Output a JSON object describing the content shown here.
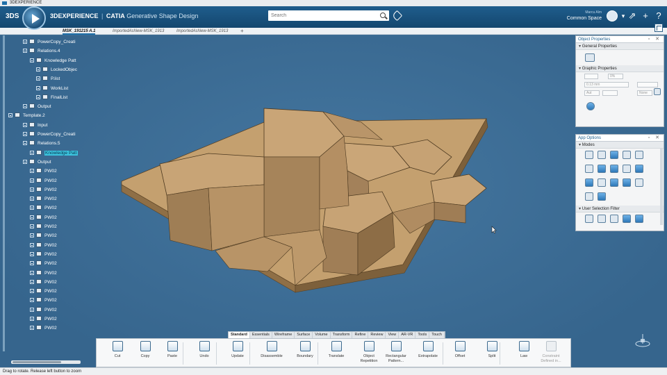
{
  "os_window": {
    "title": "3DEXPERIENCE"
  },
  "header": {
    "ds_logo": "3DS",
    "brand": {
      "platform": "3DEXPERIENCE",
      "separator": "|",
      "product": "CATIA",
      "app": "Generative Shape Design"
    },
    "search_placeholder": "Search",
    "user": {
      "name": "Marcu Alm",
      "space": "Common Space"
    },
    "icons": [
      "share-icon",
      "add-icon",
      "share-arrow-icon",
      "help-icon"
    ]
  },
  "tabs": [
    {
      "label": "MSK_191215 A.1",
      "active": true
    },
    {
      "label": "ImportedAsNew-MSK_1913",
      "active": false
    },
    {
      "label": "ImportedAsNew-MSK_1913",
      "active": false
    }
  ],
  "tab_add": "+",
  "tree": [
    {
      "label": "PowerCopy_Creati",
      "level": 2,
      "icon": "powercopy",
      "highlight": false
    },
    {
      "label": "Relations.4",
      "level": 2,
      "icon": "relations",
      "highlight": false
    },
    {
      "label": "Knowledge Patt",
      "level": 3,
      "icon": "knowledge",
      "highlight": false
    },
    {
      "label": "LockedObjec",
      "level": 4,
      "icon": "list",
      "highlight": false
    },
    {
      "label": "P.list",
      "level": 4,
      "icon": "list",
      "highlight": false
    },
    {
      "label": "WorkList",
      "level": 4,
      "icon": "list",
      "highlight": false
    },
    {
      "label": "FinalList",
      "level": 4,
      "icon": "list",
      "highlight": false
    },
    {
      "label": "Output",
      "level": 2,
      "icon": "output",
      "highlight": false
    },
    {
      "label": "Template.2",
      "level": 1,
      "icon": "template",
      "highlight": false
    },
    {
      "label": "Input",
      "level": 2,
      "icon": "input",
      "highlight": false
    },
    {
      "label": "PowerCopy_Creati",
      "level": 2,
      "icon": "powercopy",
      "highlight": false
    },
    {
      "label": "Relations.5",
      "level": 2,
      "icon": "relations",
      "highlight": false
    },
    {
      "label": "Knowledge Patt",
      "level": 3,
      "icon": "knowledge",
      "highlight": true
    },
    {
      "label": "Output",
      "level": 2,
      "icon": "output",
      "highlight": false
    },
    {
      "label": "PW02",
      "level": 3,
      "icon": "part",
      "highlight": false
    },
    {
      "label": "PW02",
      "level": 3,
      "icon": "part",
      "highlight": false
    },
    {
      "label": "PW02",
      "level": 3,
      "icon": "part",
      "highlight": false
    },
    {
      "label": "PW02",
      "level": 3,
      "icon": "part",
      "highlight": false
    },
    {
      "label": "PW02",
      "level": 3,
      "icon": "part",
      "highlight": false
    },
    {
      "label": "PW02",
      "level": 3,
      "icon": "part",
      "highlight": false
    },
    {
      "label": "PW02",
      "level": 3,
      "icon": "part",
      "highlight": false
    },
    {
      "label": "PW02",
      "level": 3,
      "icon": "part",
      "highlight": false
    },
    {
      "label": "PW02",
      "level": 3,
      "icon": "part",
      "highlight": false
    },
    {
      "label": "PW02",
      "level": 3,
      "icon": "part",
      "highlight": false
    },
    {
      "label": "PW02",
      "level": 3,
      "icon": "part",
      "highlight": false
    },
    {
      "label": "PW02",
      "level": 3,
      "icon": "part",
      "highlight": false
    },
    {
      "label": "PW02",
      "level": 3,
      "icon": "part",
      "highlight": false
    },
    {
      "label": "PW02",
      "level": 3,
      "icon": "part",
      "highlight": false
    },
    {
      "label": "PW02",
      "level": 3,
      "icon": "part",
      "highlight": false
    },
    {
      "label": "PW02",
      "level": 3,
      "icon": "part",
      "highlight": false
    },
    {
      "label": "PW02",
      "level": 3,
      "icon": "part",
      "highlight": false
    },
    {
      "label": "PW02",
      "level": 3,
      "icon": "part",
      "highlight": false
    }
  ],
  "object_properties": {
    "title": "Object Properties",
    "general_section": "General Properties",
    "graphic_section": "Graphic Properties",
    "opacity": "0%",
    "line_thickness": "0.13 mm",
    "line_type": "Aut",
    "point_symbol": "None"
  },
  "app_options": {
    "title": "App Options",
    "modes_section": "Modes",
    "filter_section": "User Selection Filter"
  },
  "action_bar": {
    "tabs": [
      {
        "label": "Standard",
        "active": true
      },
      {
        "label": "Essentials",
        "active": false
      },
      {
        "label": "Wireframe",
        "active": false
      },
      {
        "label": "Surface",
        "active": false
      },
      {
        "label": "Volume",
        "active": false
      },
      {
        "label": "Transform",
        "active": false
      },
      {
        "label": "Refine",
        "active": false
      },
      {
        "label": "Review",
        "active": false
      },
      {
        "label": "View",
        "active": false
      },
      {
        "label": "AR-VR",
        "active": false
      },
      {
        "label": "Tools",
        "active": false
      },
      {
        "label": "Touch",
        "active": false
      }
    ],
    "commands": [
      {
        "label": "Cut",
        "icon": "scissors-icon",
        "enabled": true
      },
      {
        "label": "Copy",
        "icon": "copy-icon",
        "enabled": true
      },
      {
        "label": "Paste",
        "icon": "paste-icon",
        "enabled": true
      },
      {
        "label": "Undo",
        "icon": "undo-icon",
        "enabled": true
      },
      {
        "label": "Update",
        "icon": "update-icon",
        "enabled": true
      },
      {
        "label": "Disassemble",
        "icon": "disassemble-icon",
        "enabled": true
      },
      {
        "label": "Boundary",
        "icon": "boundary-icon",
        "enabled": true
      },
      {
        "label": "Translate",
        "icon": "translate-icon",
        "enabled": true
      },
      {
        "label": "Object Repetition",
        "icon": "repetition-icon",
        "enabled": true
      },
      {
        "label": "Rectangular Pattern...",
        "icon": "pattern-icon",
        "enabled": true
      },
      {
        "label": "Extrapolate",
        "icon": "extrapolate-icon",
        "enabled": true
      },
      {
        "label": "Offset",
        "icon": "offset-icon",
        "enabled": true
      },
      {
        "label": "Split",
        "icon": "split-icon",
        "enabled": true
      },
      {
        "label": "Law",
        "icon": "law-icon",
        "enabled": true
      },
      {
        "label": "Constraint Defined in...",
        "icon": "constraint-icon",
        "enabled": false
      }
    ]
  },
  "status_bar": {
    "text": "Drag to rotate. Release left button to zoom"
  },
  "colors": {
    "header": "#1a5582",
    "viewport": "#3d6d94",
    "part_face": "#c8a374",
    "part_side": "#9c7a4f",
    "highlight": "#3cc3de"
  }
}
